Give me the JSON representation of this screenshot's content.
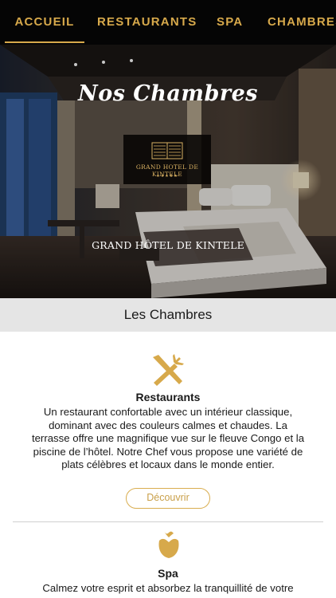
{
  "nav": {
    "tabs": [
      "ACCUEIL",
      "RESTAURANTS",
      "SPA",
      "CHAMBRES"
    ]
  },
  "hero": {
    "title": "Nos Chambres",
    "logo_name": "GRAND HOTEL DE KINTELE",
    "logo_stars": "★★★★★",
    "subtitle": "GRAND HÔTEL DE KINTELE"
  },
  "section": {
    "title": "Les Chambres"
  },
  "cards": [
    {
      "icon": "fork-knife-icon",
      "title": "Restaurants",
      "text": "Un restaurant confortable avec un intérieur classique, dominant avec des couleurs calmes et chaudes. La terrasse offre une magnifique vue sur le fleuve Congo et la piscine de l’hôtel. Notre Chef vous propose une variété de plats célèbres et locaux dans le monde entier.",
      "button": "Découvrir"
    },
    {
      "icon": "rose-icon",
      "title": "Spa",
      "text": "Calmez votre esprit et absorbez la tranquillité de votre"
    }
  ],
  "colors": {
    "gold": "#d7a94b",
    "nav_bg": "#050505",
    "section_bg": "#e5e5e5"
  }
}
